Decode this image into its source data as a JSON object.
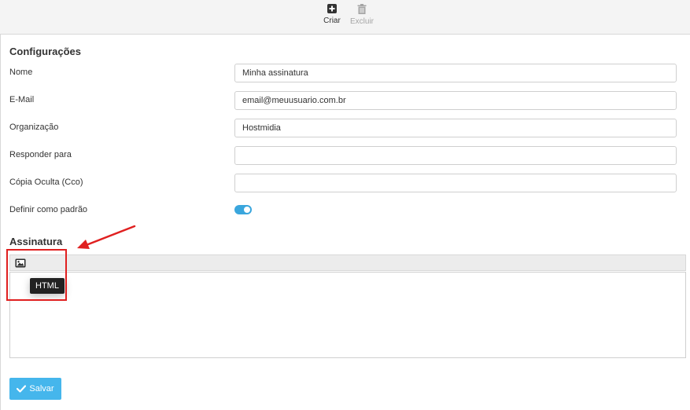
{
  "toolbar": {
    "create_label": "Criar",
    "delete_label": "Excluir"
  },
  "settings": {
    "title": "Configurações",
    "fields": [
      {
        "label": "Nome",
        "value": "Minha assinatura"
      },
      {
        "label": "E-Mail",
        "value": "email@meuusuario.com.br"
      },
      {
        "label": "Organização",
        "value": "Hostmidia"
      },
      {
        "label": "Responder para",
        "value": ""
      },
      {
        "label": "Cópia Oculta (Cco)",
        "value": ""
      }
    ],
    "default_label": "Definir como padrão",
    "default_on": true
  },
  "signature": {
    "title": "Assinatura",
    "tooltip": "HTML"
  },
  "save_label": "Salvar",
  "colors": {
    "accent": "#45b6ec",
    "toggle": "#3aa6dd",
    "annotation": "#e02020"
  }
}
